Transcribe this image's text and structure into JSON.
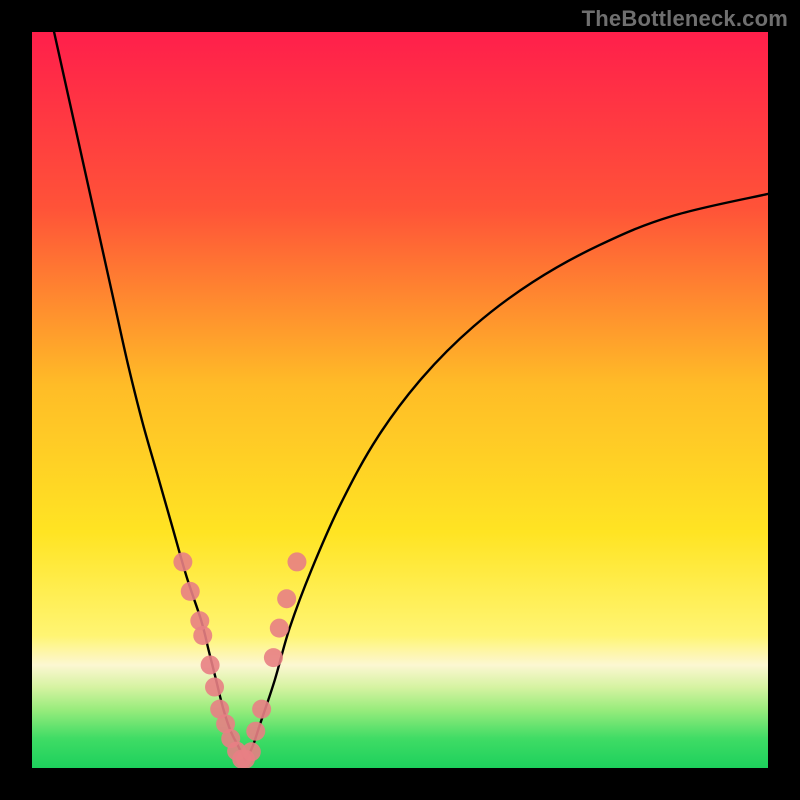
{
  "watermark": "TheBottleneck.com",
  "chart_data": {
    "type": "line",
    "title": "",
    "xlabel": "",
    "ylabel": "",
    "xlim": [
      0,
      100
    ],
    "ylim": [
      0,
      100
    ],
    "grid": false,
    "legend": false,
    "background_gradient_stops": [
      {
        "offset": 0,
        "color": "#ff1f4b"
      },
      {
        "offset": 24,
        "color": "#ff5338"
      },
      {
        "offset": 48,
        "color": "#ffbc27"
      },
      {
        "offset": 68,
        "color": "#ffe423"
      },
      {
        "offset": 82,
        "color": "#fff573"
      },
      {
        "offset": 86,
        "color": "#fcf7d2"
      },
      {
        "offset": 89,
        "color": "#d6f3a2"
      },
      {
        "offset": 92,
        "color": "#9aec7d"
      },
      {
        "offset": 96,
        "color": "#3fdc65"
      },
      {
        "offset": 100,
        "color": "#1dd05c"
      }
    ],
    "series": [
      {
        "name": "left-arm",
        "type": "line",
        "color": "#000000",
        "x": [
          3,
          5,
          7,
          9,
          11,
          13,
          15,
          17,
          19,
          21,
          23,
          24,
          25,
          26,
          27,
          28,
          29
        ],
        "y": [
          100,
          91,
          82,
          73,
          64,
          55,
          47,
          40,
          33,
          26,
          20,
          16,
          12,
          8,
          5,
          3,
          1
        ]
      },
      {
        "name": "right-arm",
        "type": "line",
        "color": "#000000",
        "x": [
          29,
          30,
          31,
          33,
          35,
          38,
          42,
          47,
          53,
          60,
          68,
          77,
          87,
          100
        ],
        "y": [
          1,
          3,
          6,
          12,
          19,
          27,
          36,
          45,
          53,
          60,
          66,
          71,
          75,
          78
        ]
      },
      {
        "name": "left-markers",
        "type": "scatter",
        "color": "#e88084",
        "x": [
          20.5,
          21.5,
          22.8,
          23.2,
          24.2,
          24.8,
          25.5,
          26.3,
          27.0,
          27.8,
          28.5
        ],
        "y": [
          28,
          24,
          20,
          18,
          14,
          11,
          8,
          6,
          4,
          2.3,
          1.2
        ]
      },
      {
        "name": "right-markers",
        "type": "scatter",
        "color": "#e88084",
        "x": [
          29.0,
          29.8,
          30.4,
          31.2,
          32.8,
          33.6,
          34.6,
          36.0
        ],
        "y": [
          1.2,
          2.2,
          5.0,
          8.0,
          15.0,
          19.0,
          23.0,
          28.0
        ]
      }
    ]
  }
}
